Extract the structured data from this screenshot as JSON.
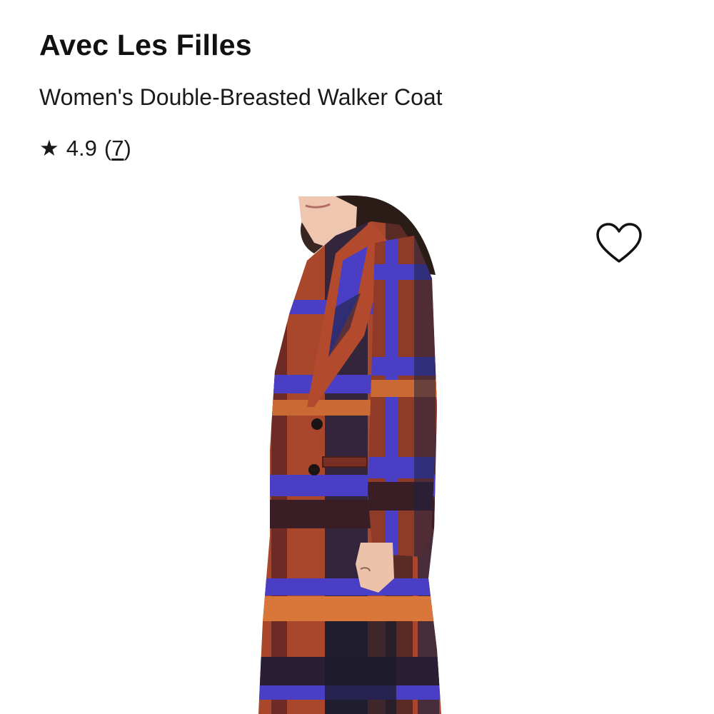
{
  "product": {
    "brand": "Avec Les Filles",
    "title": "Women's Double-Breasted Walker Coat",
    "rating": {
      "star": "★",
      "value": "4.9",
      "open_paren": "(",
      "count": "7",
      "close_paren": ")"
    }
  },
  "image": {
    "favorite_icon": "heart-outline-icon"
  },
  "colors": {
    "text": "#111111",
    "background": "#ffffff",
    "coat_rust": "#a8472b",
    "coat_blue": "#4a3fc4",
    "coat_navy": "#1e2140",
    "coat_brown": "#5a2a24"
  }
}
